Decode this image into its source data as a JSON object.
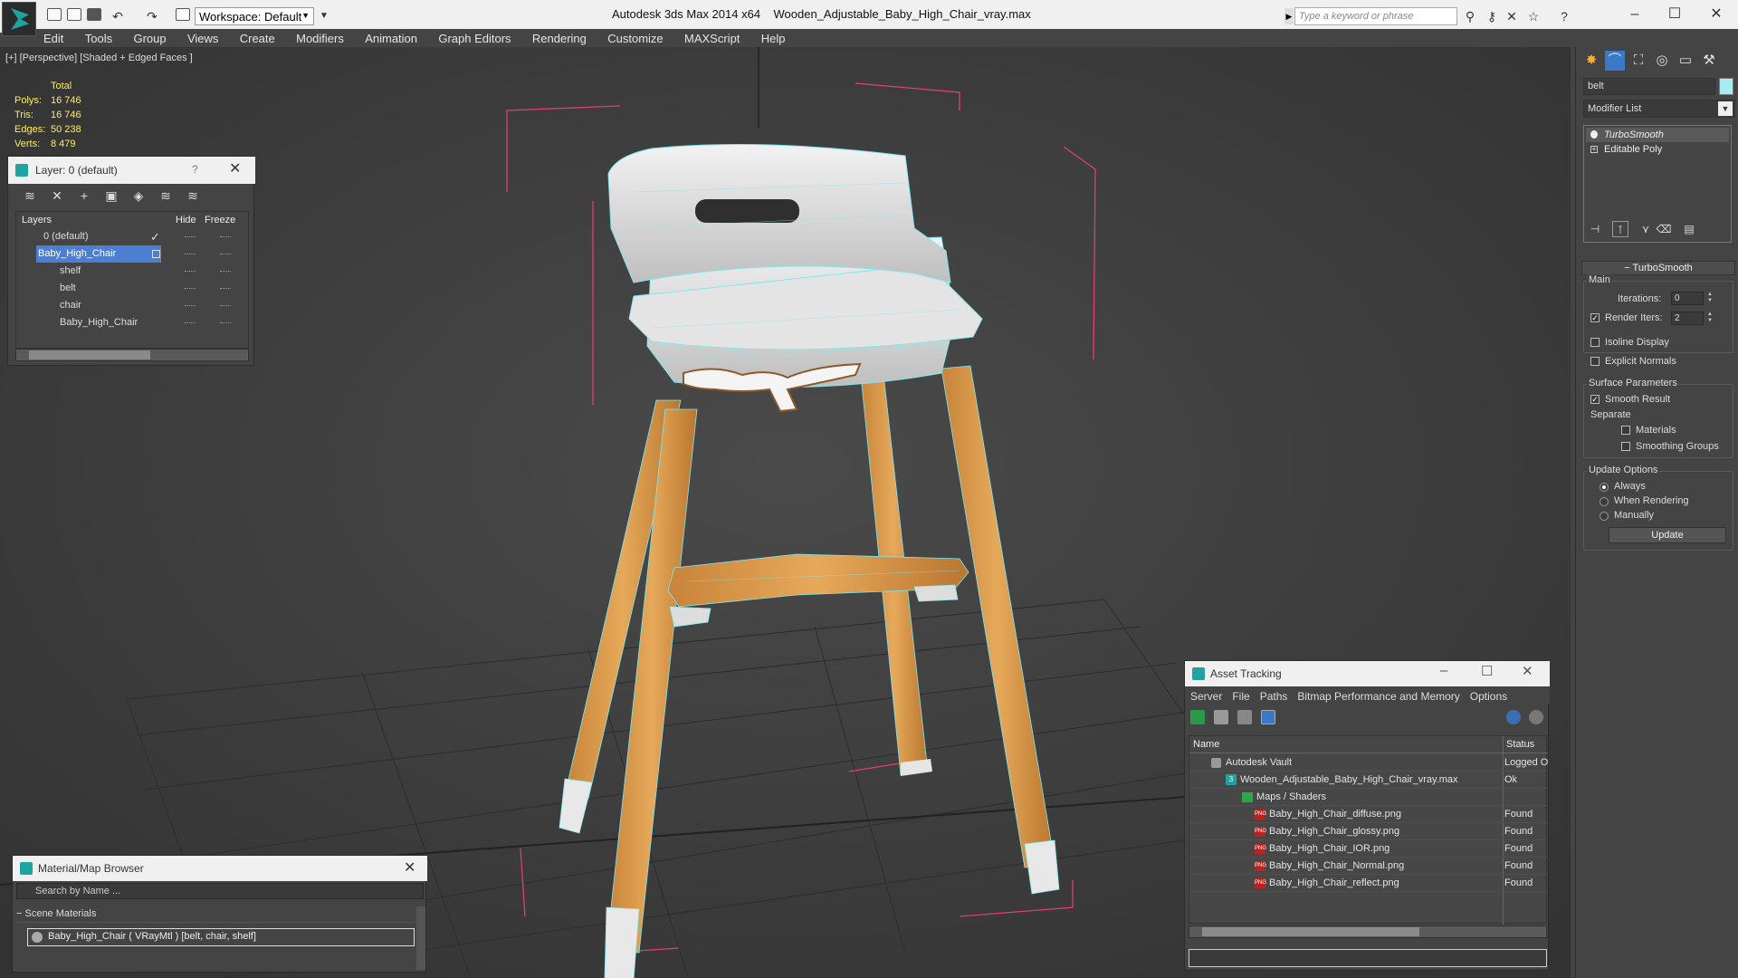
{
  "title_bar": {
    "app": "Autodesk 3ds Max  2014 x64",
    "file": "Wooden_Adjustable_Baby_High_Chair_vray.max",
    "workspace": "Workspace: Default",
    "search_placeholder": "Type a keyword or phrase"
  },
  "menu": [
    "Edit",
    "Tools",
    "Group",
    "Views",
    "Create",
    "Modifiers",
    "Animation",
    "Graph Editors",
    "Rendering",
    "Customize",
    "MAXScript",
    "Help"
  ],
  "viewport": {
    "label": "[+] [Perspective] [Shaded + Edged Faces ]",
    "stats_header": "Total",
    "stats": [
      {
        "key": "Polys:",
        "value": "16 746"
      },
      {
        "key": "Tris:",
        "value": "16 746"
      },
      {
        "key": "Edges:",
        "value": "50 238"
      },
      {
        "key": "Verts:",
        "value": "8 479"
      }
    ]
  },
  "layer_panel": {
    "title": "Layer: 0 (default)",
    "help": "?",
    "col_layers": "Layers",
    "col_hide": "Hide",
    "col_freeze": "Freeze",
    "rows": [
      {
        "name": "0 (default)"
      },
      {
        "name": "Baby_High_Chair"
      },
      {
        "name": "shelf"
      },
      {
        "name": "belt"
      },
      {
        "name": "chair"
      },
      {
        "name": "Baby_High_Chair"
      }
    ]
  },
  "material_browser": {
    "title": "Material/Map Browser",
    "search": "Search by Name ...",
    "group": "Scene Materials",
    "item": "Baby_High_Chair  ( VRayMtl )  [belt, chair, shelf]"
  },
  "asset_tracking": {
    "title": "Asset Tracking",
    "menu": [
      "Server",
      "File",
      "Paths",
      "Bitmap Performance and Memory",
      "Options"
    ],
    "col_name": "Name",
    "col_status": "Status",
    "rows": [
      {
        "name": "Autodesk Vault",
        "status": "Logged O"
      },
      {
        "name": "Wooden_Adjustable_Baby_High_Chair_vray.max",
        "status": "Ok"
      },
      {
        "name": "Maps / Shaders",
        "status": ""
      },
      {
        "name": "Baby_High_Chair_diffuse.png",
        "status": "Found"
      },
      {
        "name": "Baby_High_Chair_glossy.png",
        "status": "Found"
      },
      {
        "name": "Baby_High_Chair_IOR.png",
        "status": "Found"
      },
      {
        "name": "Baby_High_Chair_Normal.png",
        "status": "Found"
      },
      {
        "name": "Baby_High_Chair_reflect.png",
        "status": "Found"
      }
    ]
  },
  "command_panel": {
    "object_name": "belt",
    "object_color": "#a6ecf2",
    "modifier_list": "Modifier List",
    "stack": [
      "TurboSmooth",
      "Editable Poly"
    ],
    "rollout": "TurboSmooth",
    "main_group": "Main",
    "iterations_label": "Iterations:",
    "iterations_value": "0",
    "render_iters_label": "Render Iters:",
    "render_iters_value": "2",
    "isoline": "Isoline Display",
    "explicit_normals": "Explicit Normals",
    "surface_group": "Surface Parameters",
    "smooth_result": "Smooth Result",
    "separate": "Separate",
    "materials": "Materials",
    "smoothing_groups": "Smoothing Groups",
    "update_group": "Update Options",
    "always": "Always",
    "when_rendering": "When Rendering",
    "manually": "Manually",
    "update_btn": "Update"
  },
  "colors": {
    "accent_teal": "#1fa3a0",
    "selection_blue": "#4a7fd4",
    "wood": "#d89a4a",
    "wire": "#7fe8f0",
    "bbox": "#e23c78",
    "stats_yellow": "#ffee55"
  }
}
